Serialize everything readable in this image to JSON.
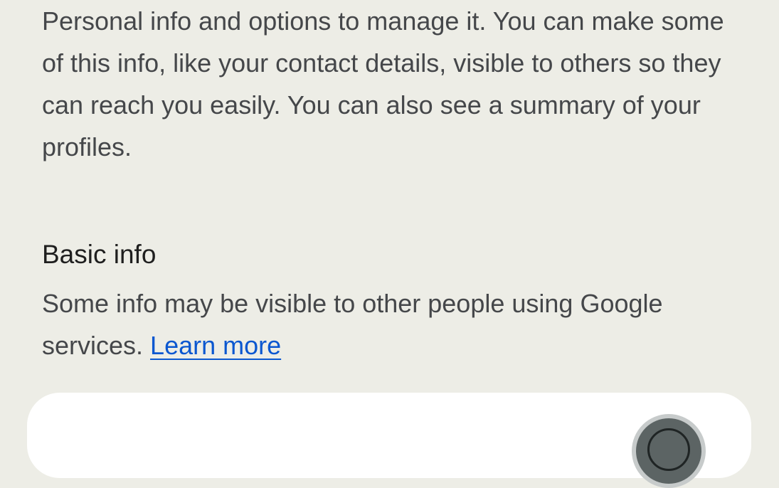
{
  "intro": {
    "text": "Personal info and options to manage it. You can make some of this info, like your contact details, visible to others so they can reach you easily. You can also see a summary of your profiles."
  },
  "basic_info": {
    "title": "Basic info",
    "description": "Some info may be visible to other people using Google services.",
    "learn_more_label": "Learn more"
  },
  "colors": {
    "background": "#edede6",
    "card": "#ffffff",
    "link": "#0b57d0",
    "body_text": "#45474a",
    "heading_text": "#1f1f1f"
  },
  "icons": {
    "profile_photo": "avatar"
  }
}
